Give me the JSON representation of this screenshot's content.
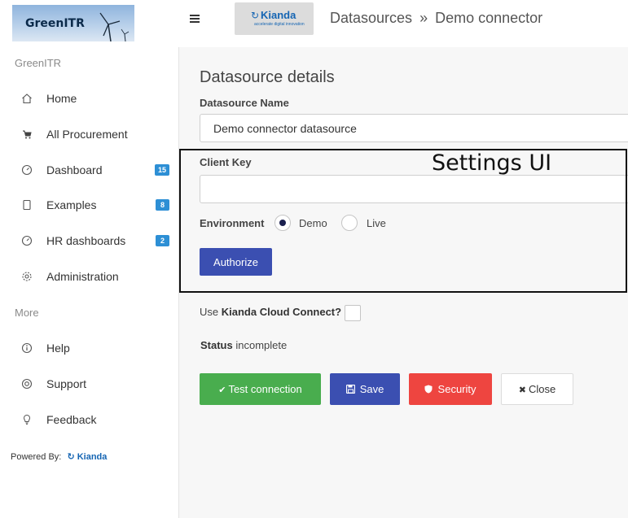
{
  "header": {
    "brand": "GreenITR",
    "kianda_logo": {
      "name": "Kianda",
      "tagline": "accelerate digital innovation"
    },
    "breadcrumb": {
      "section": "Datasources",
      "separator": "»",
      "current": "Demo connector"
    }
  },
  "sidebar": {
    "section_main": "GreenITR",
    "items": [
      {
        "label": "Home",
        "icon": "home-icon",
        "badge": ""
      },
      {
        "label": "All Procurement",
        "icon": "cart-icon",
        "badge": ""
      },
      {
        "label": "Dashboard",
        "icon": "gauge-icon",
        "badge": "15"
      },
      {
        "label": "Examples",
        "icon": "tablet-icon",
        "badge": "8"
      },
      {
        "label": "HR dashboards",
        "icon": "gauge-icon",
        "badge": "2"
      },
      {
        "label": "Administration",
        "icon": "gear-icon",
        "badge": ""
      }
    ],
    "section_more": "More",
    "more_items": [
      {
        "label": "Help",
        "icon": "info-icon"
      },
      {
        "label": "Support",
        "icon": "lifebuoy-icon"
      },
      {
        "label": "Feedback",
        "icon": "lightbulb-icon"
      }
    ],
    "powered_by": "Powered By:",
    "powered_brand": "Kianda"
  },
  "main": {
    "title": "Datasource details",
    "datasource_name_label": "Datasource Name",
    "datasource_name_value": "Demo connector datasource",
    "client_key_label": "Client Key",
    "client_key_value": "",
    "environment_label": "Environment",
    "environment_options": [
      "Demo",
      "Live"
    ],
    "environment_selected": "Demo",
    "authorize_label": "Authorize",
    "cloud_connect_prefix": "Use",
    "cloud_connect_bold": "Kianda Cloud Connect?",
    "cloud_connect_checked": false,
    "status_label": "Status",
    "status_value": "incomplete",
    "buttons": {
      "test": "Test connection",
      "save": "Save",
      "security": "Security",
      "close": "Close"
    },
    "annotation": "Settings UI"
  },
  "colors": {
    "primary": "#3b4fb1",
    "success": "#49ad4e",
    "danger": "#ee4540",
    "badge": "#2d8fd5"
  }
}
